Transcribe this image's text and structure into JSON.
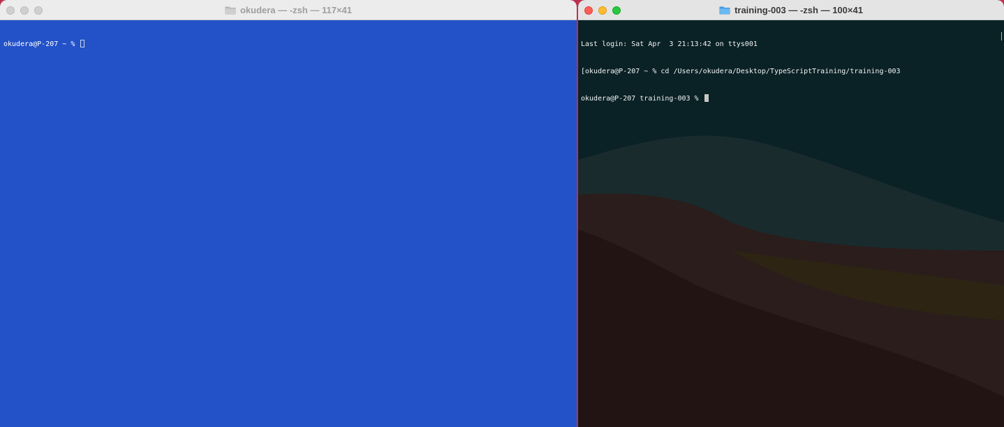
{
  "left_window": {
    "title": "okudera — -zsh — 117×41",
    "lines": [
      "okudera@P-207 ~ % "
    ]
  },
  "right_window": {
    "title": "training-003 — -zsh — 100×41",
    "lines": [
      "Last login: Sat Apr  3 21:13:42 on ttys001",
      "[okudera@P-207 ~ % cd /Users/okudera/Desktop/TypeScriptTraining/training-003",
      "okudera@P-207 training-003 % "
    ]
  },
  "colors": {
    "left_terminal_bg": "#2352c8",
    "right_terminal_bg": "#0a2226",
    "traffic_close": "#fe5f57",
    "traffic_minimize": "#febc2e",
    "traffic_zoom": "#28c840"
  },
  "icons": [
    "folder-icon",
    "cursor"
  ]
}
